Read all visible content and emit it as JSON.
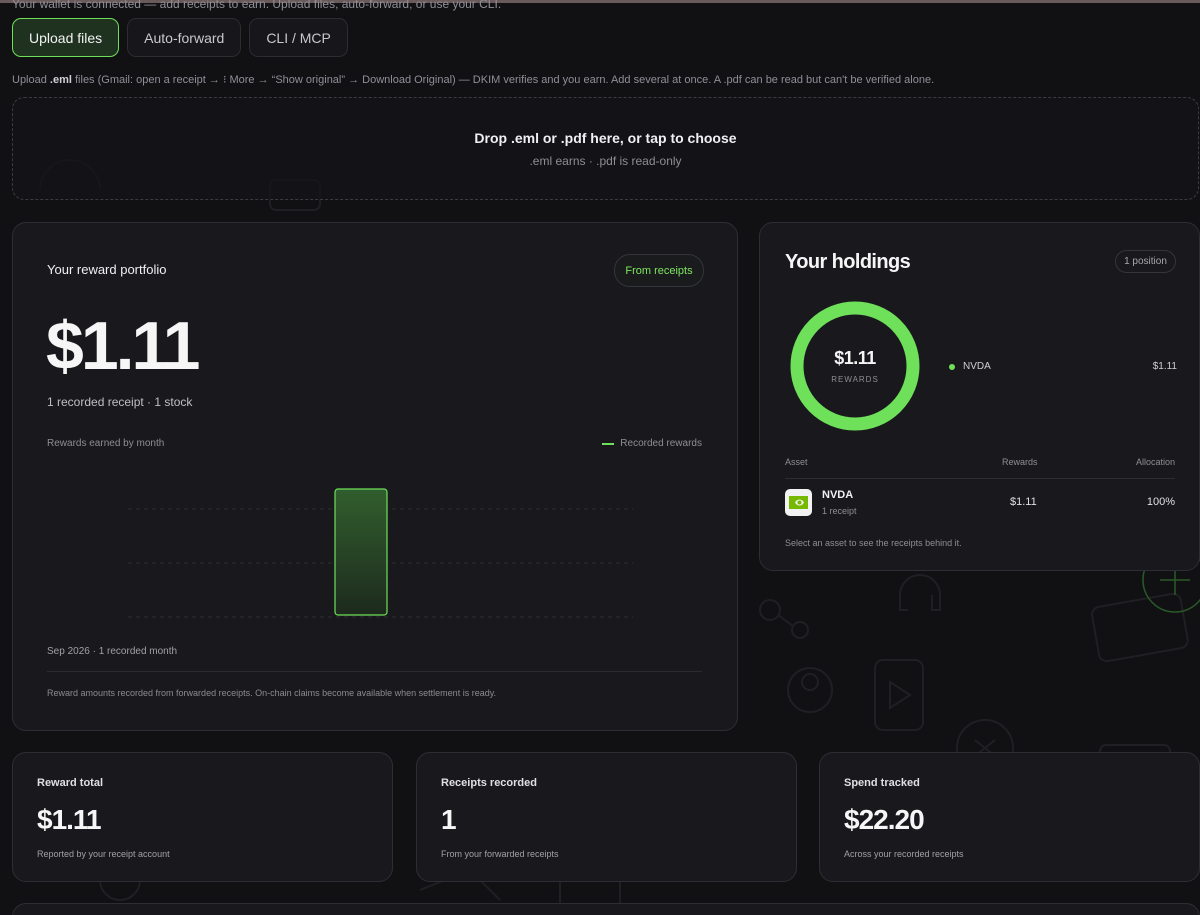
{
  "intro_text": "Your wallet is connected — add receipts to earn. Upload files, auto-forward, or use your CLI.",
  "tabs": [
    {
      "label": "Upload files",
      "active": true
    },
    {
      "label": "Auto-forward",
      "active": false
    },
    {
      "label": "CLI / MCP",
      "active": false
    }
  ],
  "help": {
    "prefix": "Upload ",
    "bold": ".eml",
    "suffix": " files (Gmail: open a receipt → ⁝ More → “Show original” → Download Original) — DKIM verifies and you earn. Add several at once. A .pdf can be read but can't be verified alone."
  },
  "dropzone": {
    "title": "Drop .eml or .pdf here, or tap to choose",
    "subtitle": ".eml earns · .pdf is read-only"
  },
  "portfolio": {
    "title": "Your reward portfolio",
    "badge": "From receipts",
    "value": "$1.11",
    "subtitle": "1 recorded receipt · 1 stock",
    "chart_label": "Rewards earned by month",
    "footer": "Sep 2026 · 1 recorded month",
    "note": "Reward amounts recorded from forwarded receipts. On-chain claims become available when settlement is ready."
  },
  "chart_data": {
    "type": "bar",
    "categories": [
      "Sep 2026"
    ],
    "series": [
      {
        "name": "Recorded rewards",
        "values": [
          1.11
        ]
      }
    ],
    "title": "Rewards earned by month",
    "grid": true,
    "legend": "top-right",
    "color": "#6fe05a"
  },
  "holdings": {
    "title": "Your holdings",
    "badge": "1 position",
    "donut_value": "$1.11",
    "donut_label": "REWARDS",
    "legend": [
      {
        "name": "NVDA",
        "value": "$1.11",
        "color": "#6fe05a",
        "share": 1.0
      }
    ],
    "table_headers": {
      "asset": "Asset",
      "rewards": "Rewards",
      "allocation": "Allocation"
    },
    "rows": [
      {
        "ticker": "NVDA",
        "sub": "1 receipt",
        "rewards": "$1.11",
        "allocation": "100%"
      }
    ],
    "note": "Select an asset to see the receipts behind it."
  },
  "stats": [
    {
      "label": "Reward total",
      "value": "$1.11",
      "sub": "Reported by your receipt account"
    },
    {
      "label": "Receipts recorded",
      "value": "1",
      "sub": "From your forwarded receipts"
    },
    {
      "label": "Spend tracked",
      "value": "$22.20",
      "sub": "Across your recorded receipts"
    }
  ],
  "icons": {
    "asset_logo": "nvidia-logo-icon",
    "legend_dot": "green-dot-icon"
  }
}
